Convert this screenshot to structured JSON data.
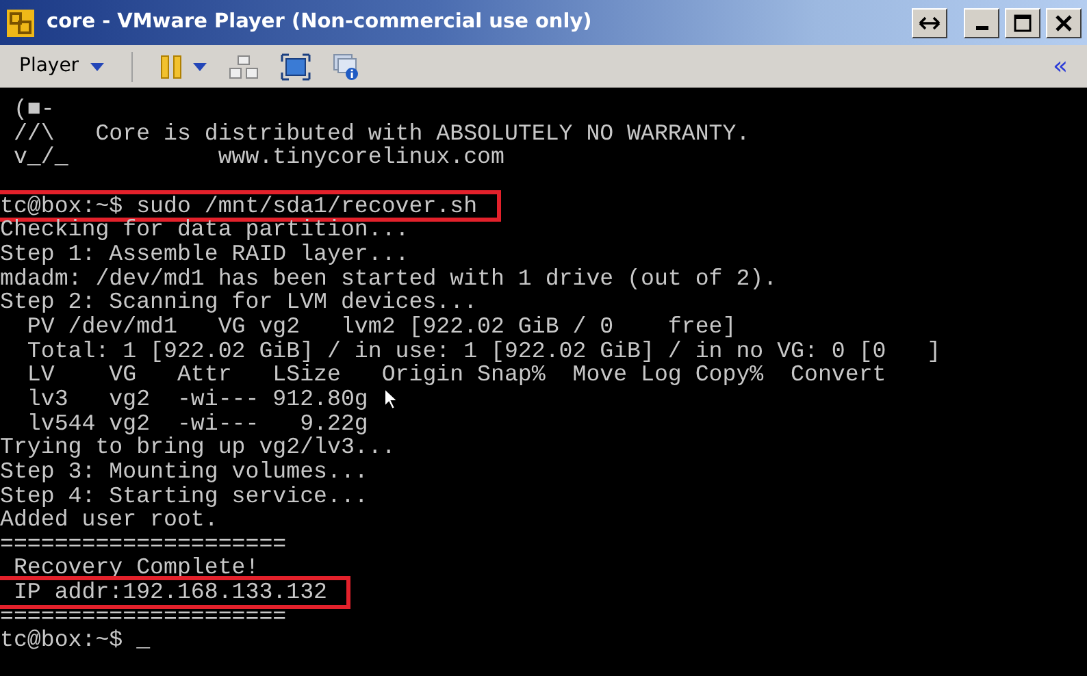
{
  "window": {
    "title": "core - VMware Player (Non-commercial use only)"
  },
  "toolbar": {
    "menu_label": "Player",
    "collapse_glyph": "«"
  },
  "terminal": {
    "lines": [
      {
        "text": " (■-",
        "highlighted": false
      },
      {
        "text": " //\\   Core is distributed with ABSOLUTELY NO WARRANTY.",
        "highlighted": false
      },
      {
        "text": " v_/_           www.tinycorelinux.com",
        "highlighted": false
      },
      {
        "highlighted": false
      },
      {
        "text": "tc@box:~$ sudo /mnt/sda1/recover.sh",
        "highlighted": true
      },
      {
        "text": "Checking for data partition...",
        "highlighted": false
      },
      {
        "text": "Step 1: Assemble RAID layer...",
        "highlighted": false
      },
      {
        "text": "mdadm: /dev/md1 has been started with 1 drive (out of 2).",
        "highlighted": false
      },
      {
        "text": "Step 2: Scanning for LVM devices...",
        "highlighted": false
      },
      {
        "text": "  PV /dev/md1   VG vg2   lvm2 [922.02 GiB / 0    free]",
        "highlighted": false
      },
      {
        "text": "  Total: 1 [922.02 GiB] / in use: 1 [922.02 GiB] / in no VG: 0 [0   ]",
        "highlighted": false
      },
      {
        "text": "  LV    VG   Attr   LSize   Origin Snap%  Move Log Copy%  Convert",
        "highlighted": false
      },
      {
        "text": "  lv3   vg2  -wi--- 912.80g",
        "highlighted": false
      },
      {
        "text": "  lv544 vg2  -wi---   9.22g",
        "highlighted": false
      },
      {
        "text": "Trying to bring up vg2/lv3...",
        "highlighted": false
      },
      {
        "text": "Step 3: Mounting volumes...",
        "highlighted": false
      },
      {
        "text": "Step 4: Starting service...",
        "highlighted": false
      },
      {
        "text": "Added user root.",
        "highlighted": false
      },
      {
        "text": "=====================",
        "highlighted": false
      },
      {
        "text": " Recovery Complete!",
        "highlighted": false
      },
      {
        "text": " IP addr:192.168.133.132",
        "highlighted": true
      },
      {
        "text": "=====================",
        "highlighted": false
      },
      {
        "text": "tc@box:~$ _",
        "highlighted": false
      }
    ]
  }
}
